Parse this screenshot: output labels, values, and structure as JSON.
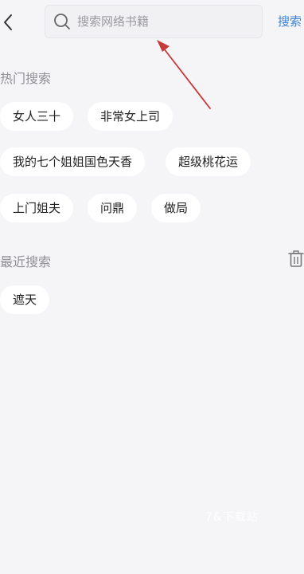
{
  "header": {
    "search_placeholder": "搜索网络书籍",
    "search_action_label": "搜索"
  },
  "hot_search": {
    "title": "热门搜索",
    "items": [
      "女人三十",
      "非常女上司",
      "我的七个姐姐国色天香",
      "超级桃花运",
      "上门姐夫",
      "问鼎",
      "做局"
    ]
  },
  "recent_search": {
    "title": "最近搜索",
    "items": [
      "遮天"
    ]
  },
  "watermark": "7&下载站",
  "icons": {
    "back": "chevron-left-icon",
    "search": "search-icon",
    "delete": "trash-icon"
  },
  "colors": {
    "background": "#f5f5f7",
    "accent": "#3a82d6",
    "annotation_arrow": "#c83a3a"
  }
}
